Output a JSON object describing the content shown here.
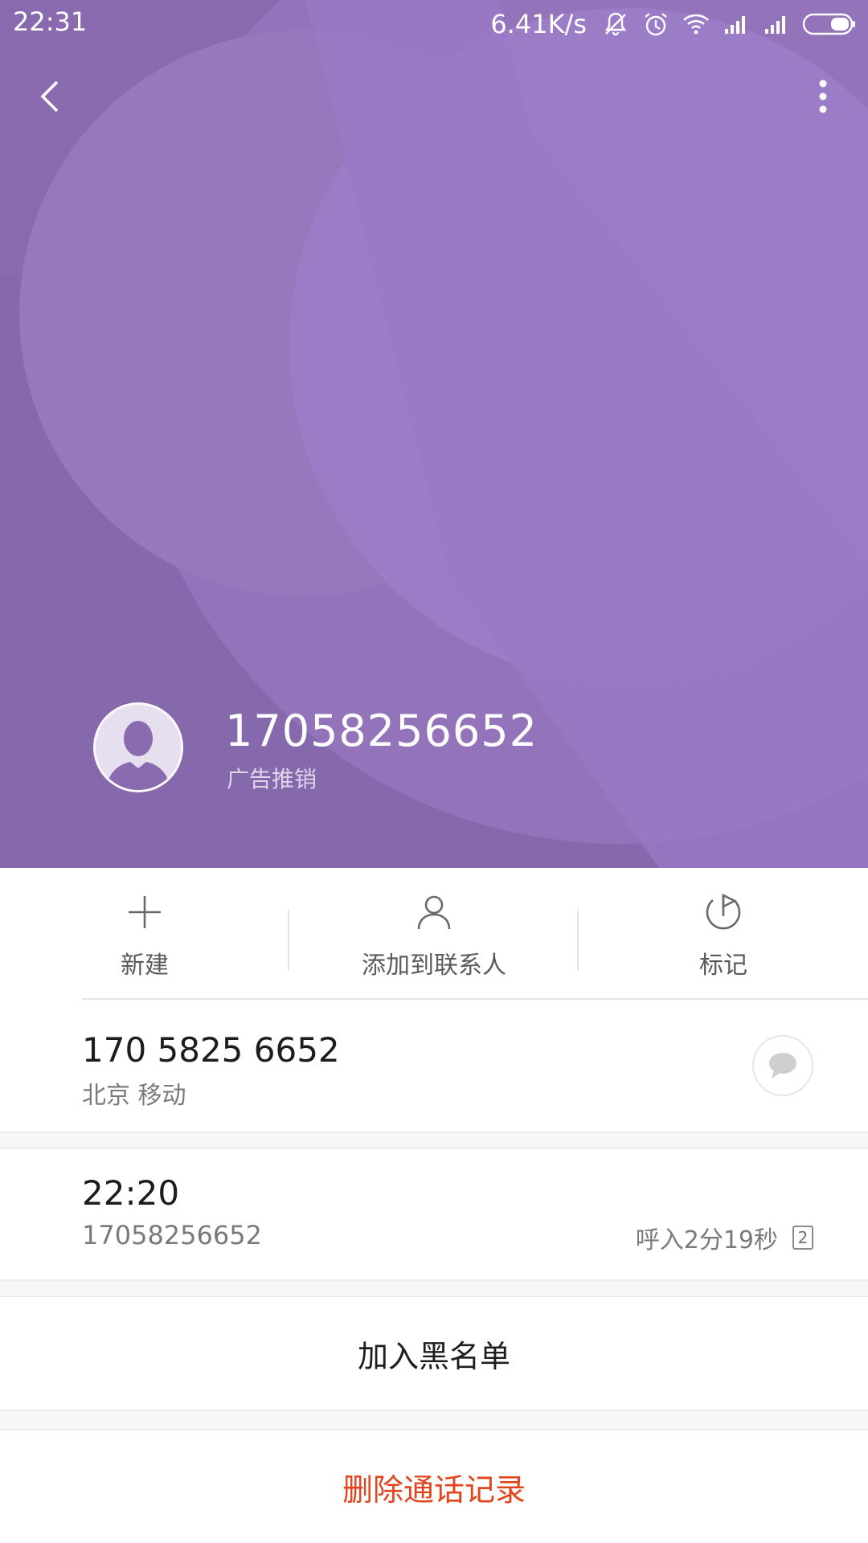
{
  "status_bar": {
    "time": "22:31",
    "net_speed": "6.41K/s",
    "icons": [
      "bell-muted-icon",
      "alarm-icon",
      "wifi-icon",
      "signal-icon",
      "signal-icon",
      "battery-icon"
    ]
  },
  "header": {
    "bg_color": "#8a6bb0",
    "number": "17058256652",
    "tag": "广告推销"
  },
  "actions": [
    {
      "label": "新建",
      "icon": "plus-icon"
    },
    {
      "label": "添加到联系人",
      "icon": "person-icon"
    },
    {
      "label": "标记",
      "icon": "flag-icon"
    }
  ],
  "number_info": {
    "formatted": "170 5825 6652",
    "location": "北京 移动"
  },
  "call_log": {
    "time": "22:20",
    "number": "17058256652",
    "detail": "呼入2分19秒",
    "sim": "2"
  },
  "buttons": {
    "blacklist": "加入黑名单",
    "delete": "删除通话记录",
    "delete_color": "#e0451e"
  }
}
